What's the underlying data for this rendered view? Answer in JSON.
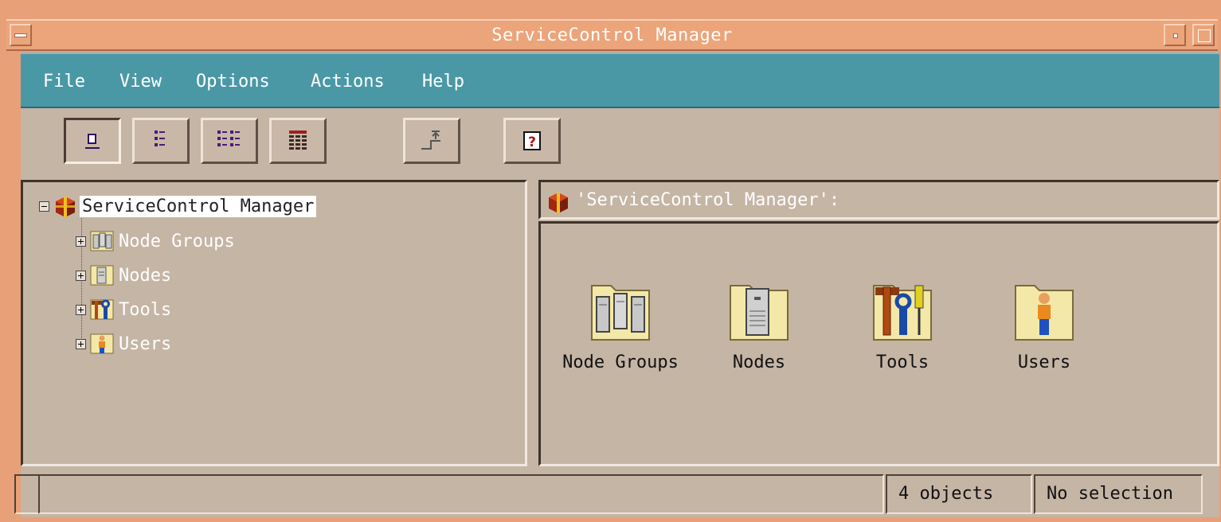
{
  "window": {
    "title": "ServiceControl Manager"
  },
  "menu": {
    "file": "File",
    "view": "View",
    "options": "Options",
    "actions": "Actions",
    "help": "Help"
  },
  "toolbar": {
    "buttons": [
      "large-icons-view-icon",
      "small-icons-view-icon",
      "list-view-icon",
      "details-view-icon",
      "up-one-level-icon",
      "help-icon"
    ]
  },
  "tree": {
    "root": "ServiceControl Manager",
    "children": [
      "Node Groups",
      "Nodes",
      "Tools",
      "Users"
    ]
  },
  "content": {
    "header": "'ServiceControl Manager':",
    "items": [
      "Node Groups",
      "Nodes",
      "Tools",
      "Users"
    ]
  },
  "status": {
    "message": "",
    "count": "4 objects",
    "selection": "No selection"
  },
  "colors": {
    "titlebar": "#eca47a",
    "menubar": "#4a98a6",
    "background": "#c5b5a5"
  }
}
